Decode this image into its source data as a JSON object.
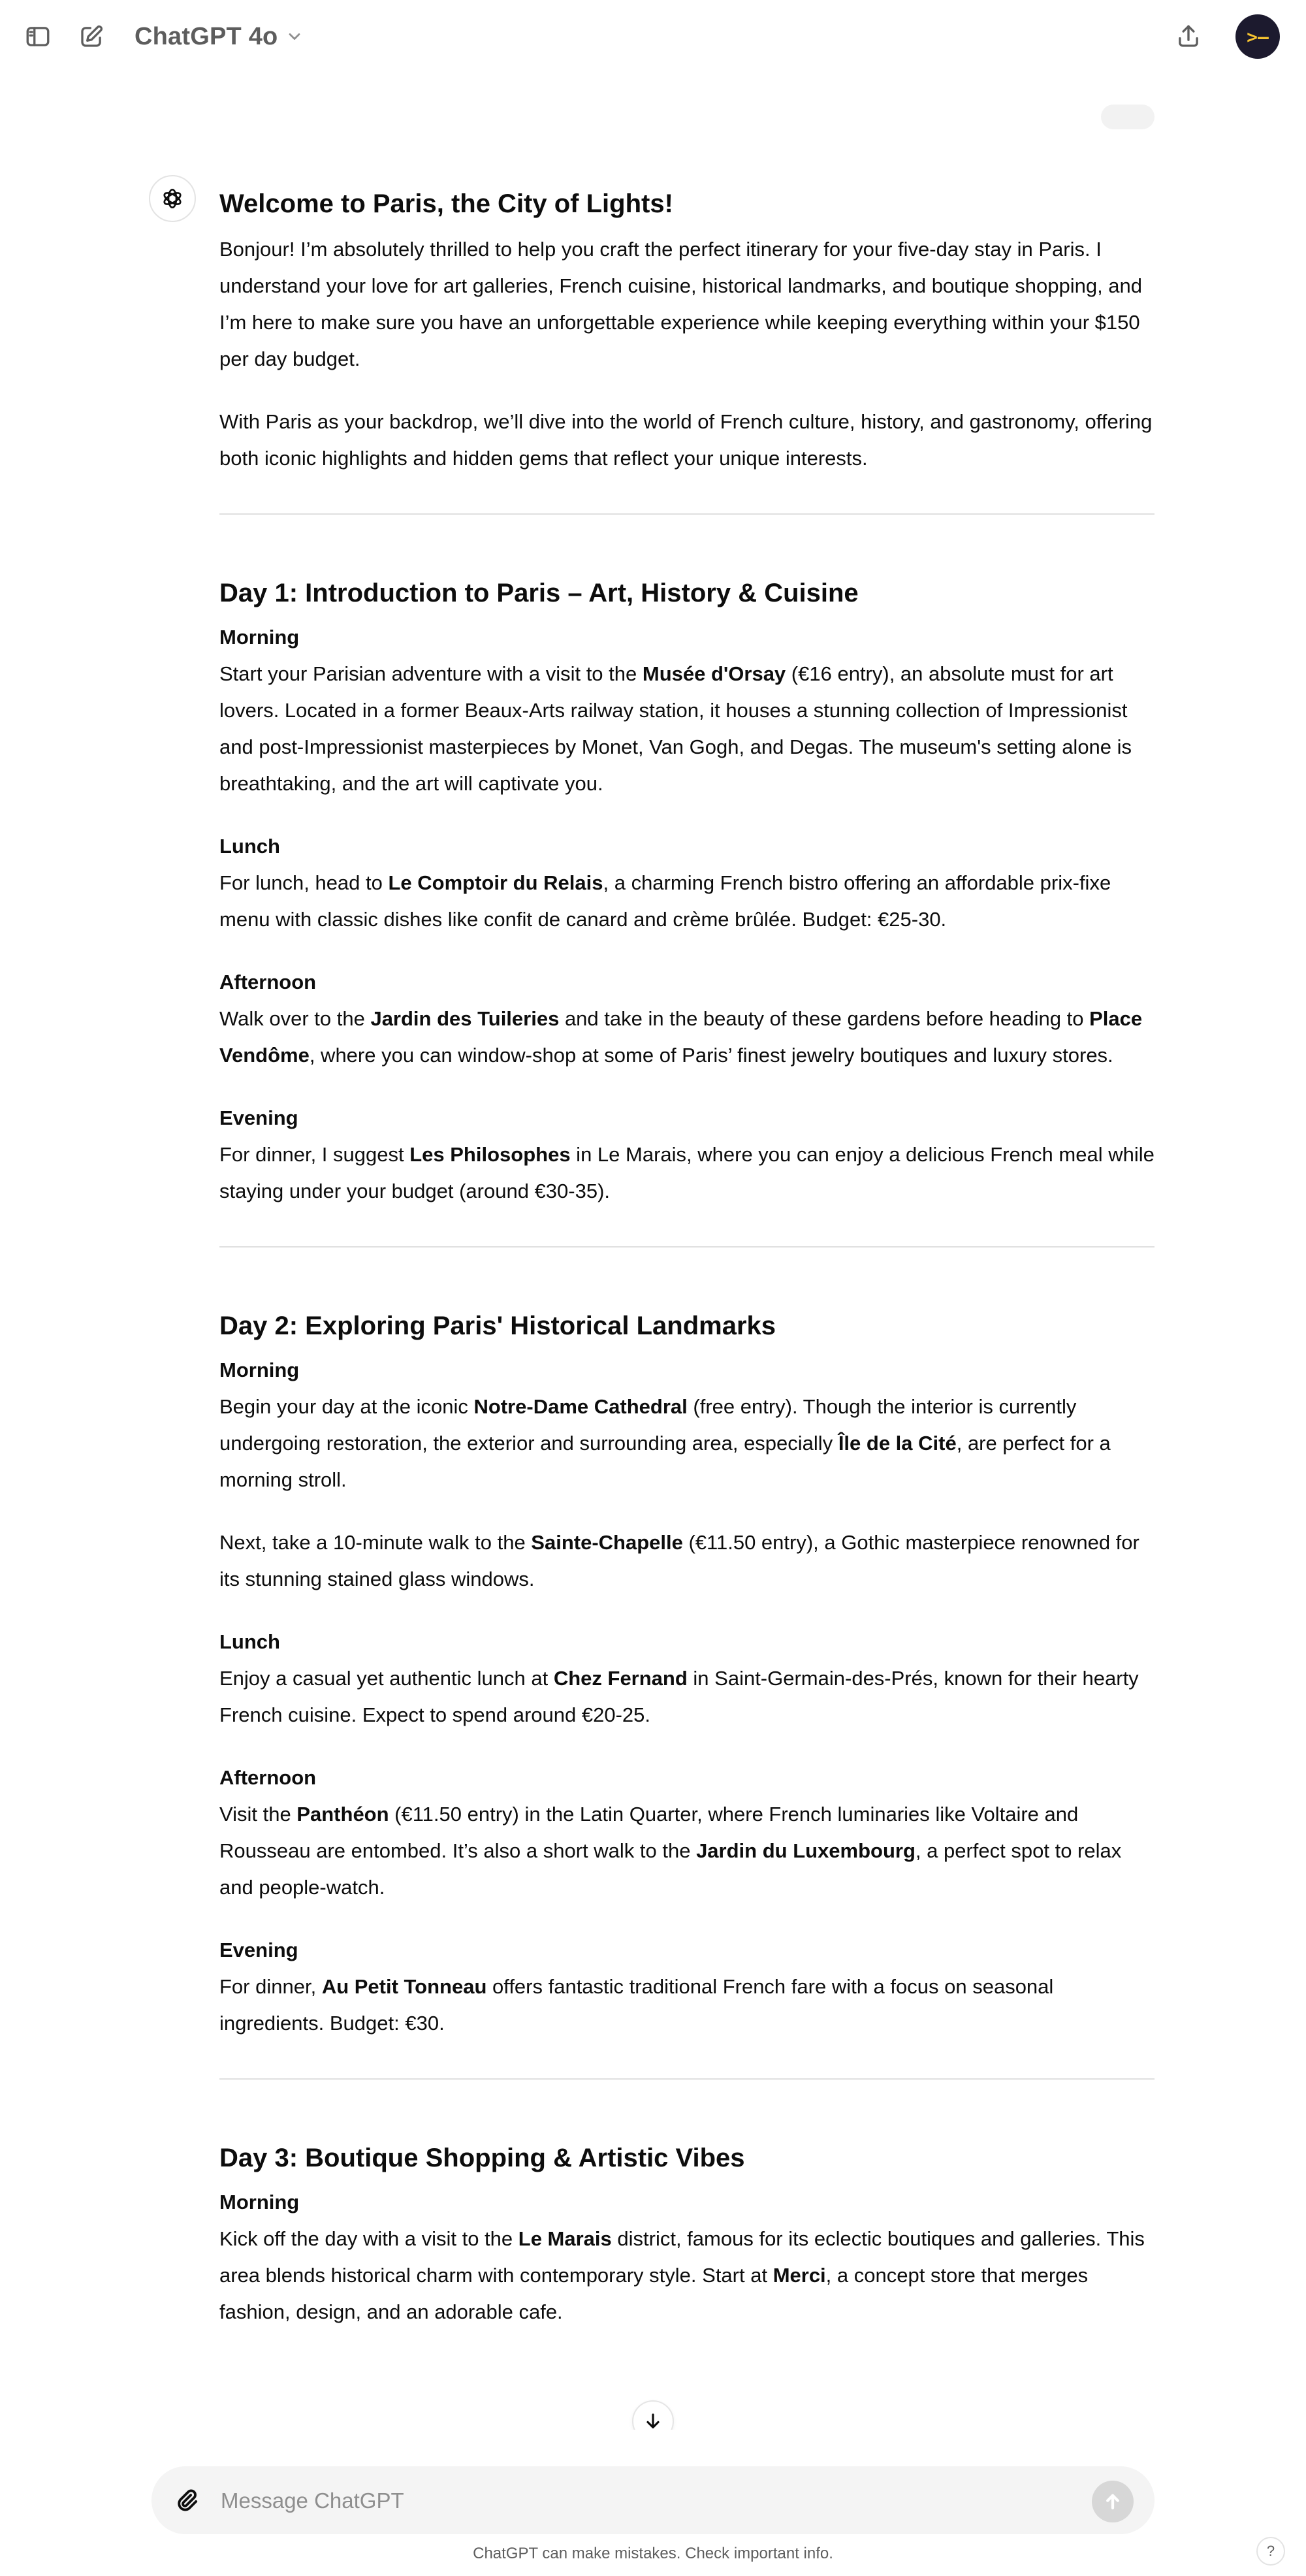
{
  "header": {
    "model_name": "ChatGPT 4o",
    "sidebar_icon": "sidebar-toggle-icon",
    "new_chat_icon": "new-chat-icon",
    "share_icon": "share-icon",
    "avatar_text": ">–"
  },
  "message": {
    "title": "Welcome to Paris, the City of Lights!",
    "intro": [
      "Bonjour! I’m absolutely thrilled to help you craft the perfect itinerary for your five-day stay in Paris. I understand your love for art galleries, French cuisine, historical landmarks, and boutique shopping, and I’m here to make sure you have an unforgettable experience while keeping everything within your $150 per day budget.",
      "With Paris as your backdrop, we’ll dive into the world of French culture, history, and gastronomy, offering both iconic highlights and hidden gems that reflect your unique interests."
    ],
    "days": [
      {
        "title": "Day 1: Introduction to Paris – Art, History & Cuisine",
        "sections": [
          {
            "label": "Morning",
            "paragraphs": [
              [
                {
                  "t": "Start your Parisian adventure with a visit to the "
                },
                {
                  "t": "Musée d'Orsay",
                  "b": true
                },
                {
                  "t": " (€16 entry), an absolute must for art lovers. Located in a former Beaux-Arts railway station, it houses a stunning collection of Impressionist and post-Impressionist masterpieces by Monet, Van Gogh, and Degas. The museum's setting alone is breathtaking, and the art will captivate you."
                }
              ]
            ]
          },
          {
            "label": "Lunch",
            "paragraphs": [
              [
                {
                  "t": "For lunch, head to "
                },
                {
                  "t": "Le Comptoir du Relais",
                  "b": true
                },
                {
                  "t": ", a charming French bistro offering an affordable prix-fixe menu with classic dishes like confit de canard and crème brûlée. Budget: €25-30."
                }
              ]
            ]
          },
          {
            "label": "Afternoon",
            "paragraphs": [
              [
                {
                  "t": "Walk over to the "
                },
                {
                  "t": "Jardin des Tuileries",
                  "b": true
                },
                {
                  "t": " and take in the beauty of these gardens before heading to "
                },
                {
                  "t": "Place Vendôme",
                  "b": true
                },
                {
                  "t": ", where you can window-shop at some of Paris’ finest jewelry boutiques and luxury stores."
                }
              ]
            ]
          },
          {
            "label": "Evening",
            "paragraphs": [
              [
                {
                  "t": "For dinner, I suggest "
                },
                {
                  "t": "Les Philosophes",
                  "b": true
                },
                {
                  "t": " in Le Marais, where you can enjoy a delicious French meal while staying under your budget (around €30-35)."
                }
              ]
            ]
          }
        ]
      },
      {
        "title": "Day 2: Exploring Paris' Historical Landmarks",
        "sections": [
          {
            "label": "Morning",
            "paragraphs": [
              [
                {
                  "t": "Begin your day at the iconic "
                },
                {
                  "t": "Notre-Dame Cathedral",
                  "b": true
                },
                {
                  "t": " (free entry). Though the interior is currently undergoing restoration, the exterior and surrounding area, especially "
                },
                {
                  "t": "Île de la Cité",
                  "b": true
                },
                {
                  "t": ", are perfect for a morning stroll."
                }
              ],
              [
                {
                  "t": "Next, take a 10-minute walk to the "
                },
                {
                  "t": "Sainte-Chapelle",
                  "b": true
                },
                {
                  "t": " (€11.50 entry), a Gothic masterpiece renowned for its stunning stained glass windows."
                }
              ]
            ]
          },
          {
            "label": "Lunch",
            "paragraphs": [
              [
                {
                  "t": "Enjoy a casual yet authentic lunch at "
                },
                {
                  "t": "Chez Fernand",
                  "b": true
                },
                {
                  "t": " in Saint-Germain-des-Prés, known for their hearty French cuisine. Expect to spend around €20-25."
                }
              ]
            ]
          },
          {
            "label": "Afternoon",
            "paragraphs": [
              [
                {
                  "t": "Visit the "
                },
                {
                  "t": "Panthéon",
                  "b": true
                },
                {
                  "t": " (€11.50 entry) in the Latin Quarter, where French luminaries like Voltaire and Rousseau are entombed. It’s also a short walk to the "
                },
                {
                  "t": "Jardin du Luxembourg",
                  "b": true
                },
                {
                  "t": ", a perfect spot to relax and people-watch."
                }
              ]
            ]
          },
          {
            "label": "Evening",
            "paragraphs": [
              [
                {
                  "t": "For dinner, "
                },
                {
                  "t": "Au Petit Tonneau",
                  "b": true
                },
                {
                  "t": " offers fantastic traditional French fare with a focus on seasonal ingredients. Budget: €30."
                }
              ]
            ]
          }
        ]
      },
      {
        "title": "Day 3: Boutique Shopping & Artistic Vibes",
        "sections": [
          {
            "label": "Morning",
            "paragraphs": [
              [
                {
                  "t": "Kick off the day with a visit to the "
                },
                {
                  "t": "Le Marais",
                  "b": true
                },
                {
                  "t": " district, famous for its eclectic boutiques and galleries. This area blends historical charm with contemporary style. Start at "
                },
                {
                  "t": "Merci",
                  "b": true
                },
                {
                  "t": ", a concept store that merges fashion, design, and an adorable cafe."
                }
              ]
            ]
          }
        ]
      }
    ]
  },
  "composer": {
    "placeholder": "Message ChatGPT",
    "attach_icon": "paperclip-icon",
    "send_icon": "send-arrow-icon"
  },
  "footer": {
    "disclaimer": "ChatGPT can make mistakes. Check important info.",
    "help_label": "?"
  },
  "colors": {
    "text": "#0d0d0d",
    "muted": "#5d5d5d",
    "composer_bg": "#f4f4f4",
    "avatar_bg": "#1c1a2e",
    "avatar_fg": "#f5c330"
  }
}
